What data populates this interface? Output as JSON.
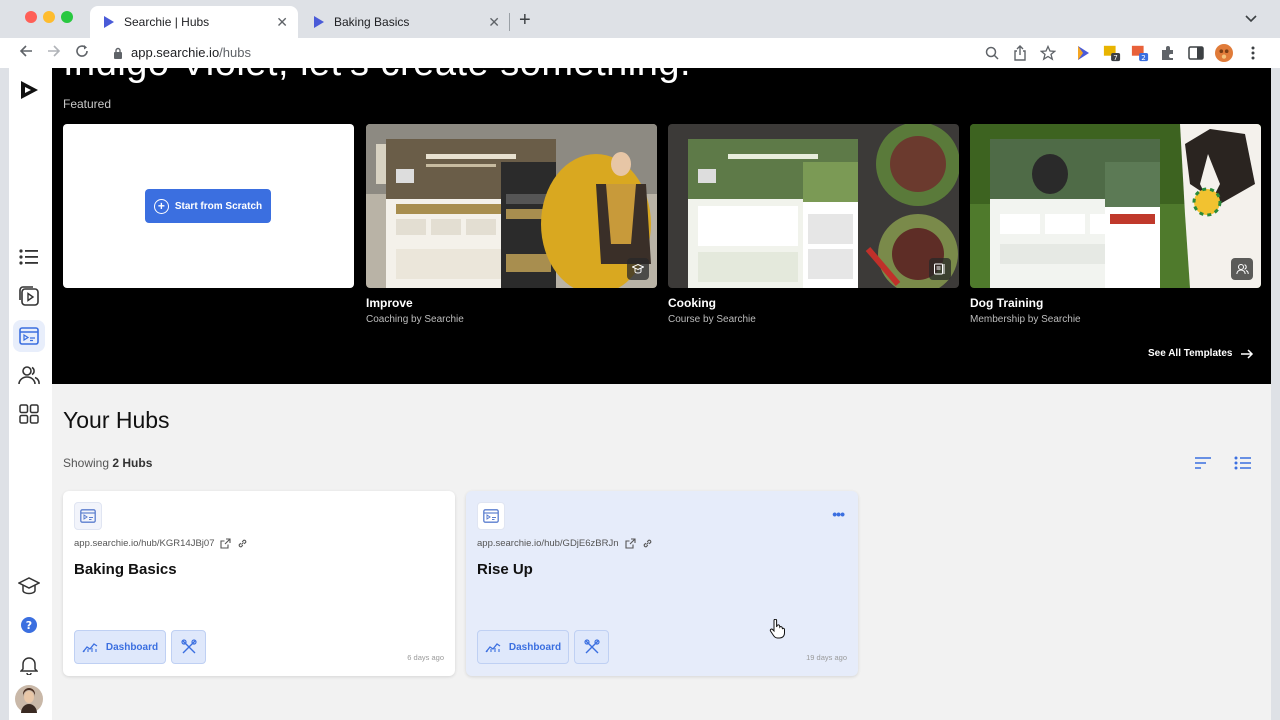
{
  "browser": {
    "tabs": [
      {
        "title": "Searchie | Hubs",
        "active": true
      },
      {
        "title": "Baking Basics",
        "active": false
      }
    ],
    "new_tab": "+",
    "url_host": "app.searchie.io",
    "url_path": "/hubs",
    "extension_badges": [
      "7",
      "2"
    ]
  },
  "hero": {
    "greeting": "Indigo Violet, let’s create something.",
    "featured_label": "Featured",
    "start_button": "Start from Scratch",
    "templates": [
      {
        "title": "Improve",
        "subtitle": "Coaching by Searchie",
        "badge_icon": "graduation-cap-icon"
      },
      {
        "title": "Cooking",
        "subtitle": "Course by Searchie",
        "badge_icon": "lesson-icon"
      },
      {
        "title": "Dog Training",
        "subtitle": "Membership by Searchie",
        "badge_icon": "members-icon"
      }
    ],
    "see_all": "See All Templates"
  },
  "hubs": {
    "heading": "Your Hubs",
    "showing_prefix": "Showing",
    "showing_count": "2 Hubs",
    "items": [
      {
        "url": "app.searchie.io/hub/KGR14JBj07",
        "name": "Baking Basics",
        "dashboard_label": "Dashboard",
        "updated": "6 days ago"
      },
      {
        "url": "app.searchie.io/hub/GDjE6zBRJn",
        "name": "Rise Up",
        "dashboard_label": "Dashboard",
        "updated": "19 days ago"
      }
    ]
  },
  "colors": {
    "accent": "#3b6fe0",
    "hero_bg": "#000000",
    "main_bg": "#f2f2f2",
    "hover_card": "#e6ecfa"
  }
}
